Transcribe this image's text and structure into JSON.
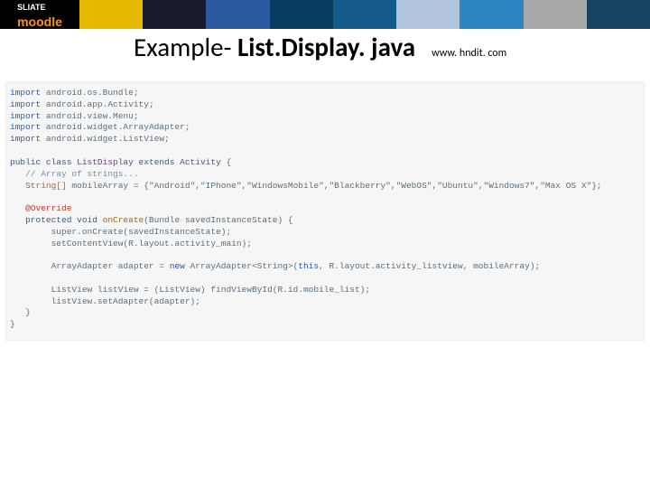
{
  "banner": {
    "logo_top": "SLIATE",
    "logo_bottom": "moodle"
  },
  "headline": {
    "prefix": "Example- ",
    "bold": "List.Display. java",
    "url": "www. hndit. com"
  },
  "code": {
    "l1_kw": "import",
    "l1_rest": " android.os.Bundle;",
    "l2_kw": "import",
    "l2_rest": " android.app.Activity;",
    "l3_kw": "import",
    "l3_rest": " android.view.Menu;",
    "l4_kw": "import",
    "l4_rest": " android.widget.ArrayAdapter;",
    "l5_kw": "import",
    "l5_rest": " android.widget.ListView;",
    "l7_kw": "public class ",
    "l7_cls": "ListDisplay",
    "l7_ext": " extends ",
    "l7_sup": "Activity",
    "l7_end": " {",
    "l8": "   // Array of strings...",
    "l9_t": "   String[] ",
    "l9_v": "mobileArray = {",
    "l9_s": "\"Android\",\"IPhone\",\"WindowsMobile\",\"Blackberry\",\"WebOS\",\"Ubuntu\",\"Windows7\",\"Max OS X\"",
    "l9_e": "};",
    "l11": "   @Override",
    "l12_kw": "   protected void ",
    "l12_m": "onCreate",
    "l12_p": "(Bundle savedInstanceState) {",
    "l13": "        super.onCreate(savedInstanceState);",
    "l14": "        setContentView(R.layout.activity_main);",
    "l16a": "        ArrayAdapter adapter = ",
    "l16n": "new",
    "l16b": " ArrayAdapter<String>(",
    "l16c": "this",
    "l16d": ", R.layout.activity_listview, mobileArray);",
    "l18": "        ListView listView = (ListView) findViewById(R.id.mobile_list);",
    "l19": "        listView.setAdapter(adapter);",
    "l20": "   }",
    "l21": "}"
  }
}
